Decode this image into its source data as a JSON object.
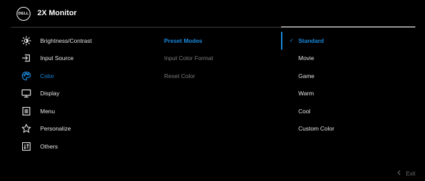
{
  "header": {
    "logo_text": "DELL",
    "title": "2X Monitor"
  },
  "menu": [
    {
      "label": "Brightness/Contrast",
      "icon": "brightness-icon",
      "active": false
    },
    {
      "label": "Input Source",
      "icon": "input-source-icon",
      "active": false
    },
    {
      "label": "Color",
      "icon": "color-palette-icon",
      "active": true
    },
    {
      "label": "Display",
      "icon": "display-icon",
      "active": false
    },
    {
      "label": "Menu",
      "icon": "menu-icon",
      "active": false
    },
    {
      "label": "Personalize",
      "icon": "star-icon",
      "active": false
    },
    {
      "label": "Others",
      "icon": "others-icon",
      "active": false
    }
  ],
  "submenu": [
    {
      "label": "Preset Modes",
      "active": true
    },
    {
      "label": "Input Color Format",
      "active": false
    },
    {
      "label": "Reset Color",
      "active": false
    }
  ],
  "options": [
    {
      "label": "Standard",
      "selected": true
    },
    {
      "label": "Movie",
      "selected": false
    },
    {
      "label": "Game",
      "selected": false
    },
    {
      "label": "Warm",
      "selected": false
    },
    {
      "label": "Cool",
      "selected": false
    },
    {
      "label": "Custom Color",
      "selected": false
    }
  ],
  "footer": {
    "exit_label": "Exit"
  },
  "colors": {
    "accent": "#1a8be0",
    "background": "#000000",
    "text": "#e6e6e6",
    "muted": "#7a7a7a"
  }
}
